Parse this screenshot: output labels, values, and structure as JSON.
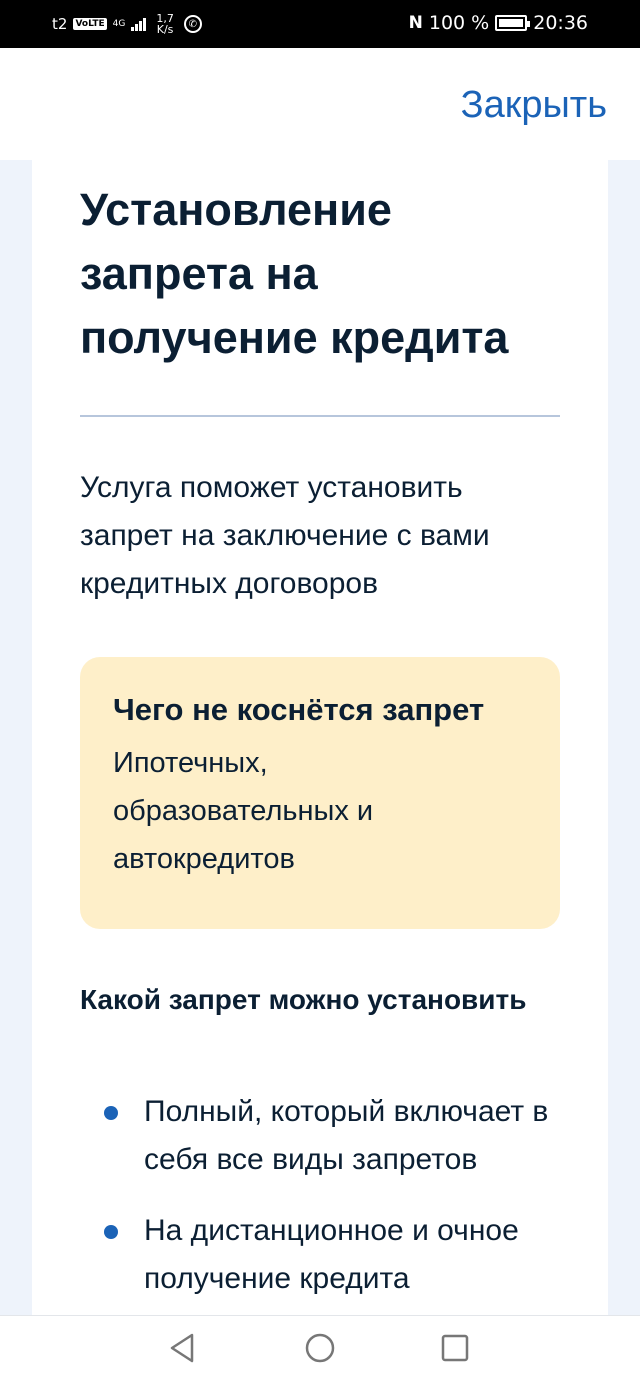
{
  "status_bar": {
    "carrier": "t2",
    "volte": "VoLTE",
    "network": "4G",
    "speed_value": "1,7",
    "speed_unit": "K/s",
    "nfc": "N",
    "battery_text": "100 %",
    "battery_level": 1.0,
    "time": "20:36"
  },
  "header": {
    "close_label": "Закрыть"
  },
  "page": {
    "title": "Установление запрета на получение кредита",
    "intro": "Услуга поможет установить запрет на заключение с вами кредитных договоров",
    "note": {
      "title": "Чего не коснётся запрет",
      "text": "Ипотечных, образовательных и автокредитов"
    },
    "section_title": "Какой запрет можно установить",
    "options": [
      {
        "text": "Полный, который включает в себя все виды запретов"
      },
      {
        "text": "На дистанционное и очное получение кредита"
      }
    ]
  },
  "colors": {
    "accent": "#1b63b7",
    "note_background": "#feefc9",
    "page_background": "#eef3fb"
  },
  "nav_bar": {
    "icons": [
      "back-icon",
      "home-icon",
      "recents-icon"
    ]
  }
}
